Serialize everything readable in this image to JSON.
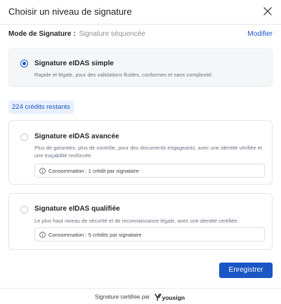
{
  "dialog": {
    "title": "Choisir un niveau de signature",
    "close_icon": "close-icon"
  },
  "mode": {
    "label": "Mode de Signature :",
    "value": "Signature séquencée",
    "link": "Modifier"
  },
  "options": [
    {
      "title": "Signature eIDAS simple",
      "description": "Rapide et légale, pour des validations fluides, conformes et sans complexité.",
      "selected": true
    },
    {
      "title": "Signature eIDAS avancée",
      "description": "Plus de garanties, plus de contrôle, pour des documents engageants, avec une identité vérifiée et une traçabilité renforcée.",
      "consumption": "Consommation : 1 crédit par signataire",
      "selected": false
    },
    {
      "title": "Signature eIDAS qualifiée",
      "description": "Le plus haut niveau de sécurité et de reconnaissance légale, avec une identité certifiée.",
      "consumption": "Consommation : 5 crédits par signataire",
      "selected": false
    }
  ],
  "credits": {
    "label": "224 crédits restants"
  },
  "actions": {
    "save_label": "Enregistrer"
  },
  "footer": {
    "text": "Signature certifiée par",
    "brand": "yousign"
  },
  "colors": {
    "accent": "#1a56c4",
    "credits_bg": "#e8f0fc",
    "selected_card_bg": "#f5f6f8"
  }
}
